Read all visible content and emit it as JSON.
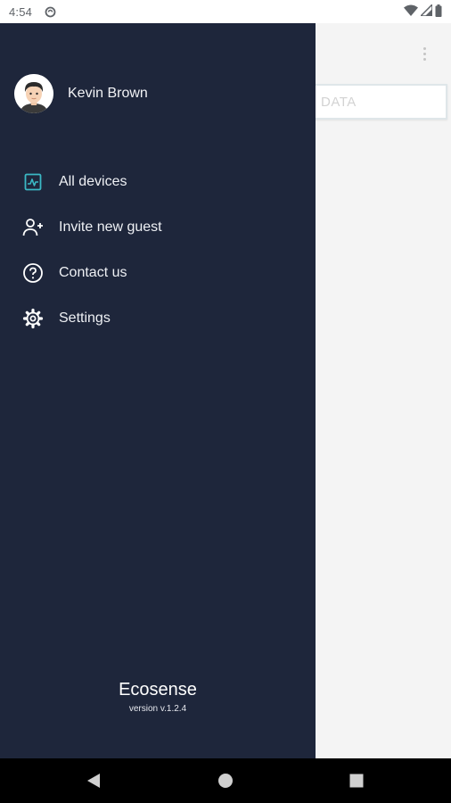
{
  "status_bar": {
    "time": "4:54"
  },
  "main": {
    "data_tab_label": "DATA"
  },
  "drawer": {
    "user_name": "Kevin Brown",
    "menu_items": [
      {
        "label": "All devices",
        "icon": "activity-chart-icon",
        "color": "#3bb8c4"
      },
      {
        "label": "Invite new guest",
        "icon": "add-user-icon",
        "color": "#ffffff"
      },
      {
        "label": "Contact us",
        "icon": "help-circle-icon",
        "color": "#ffffff"
      },
      {
        "label": "Settings",
        "icon": "gear-icon",
        "color": "#ffffff"
      }
    ],
    "app_name": "Ecosense",
    "version": "version v.1.2.4"
  },
  "colors": {
    "drawer_background": "#1e263b",
    "accent": "#3bb8c4",
    "content_background": "#f4f4f4"
  }
}
